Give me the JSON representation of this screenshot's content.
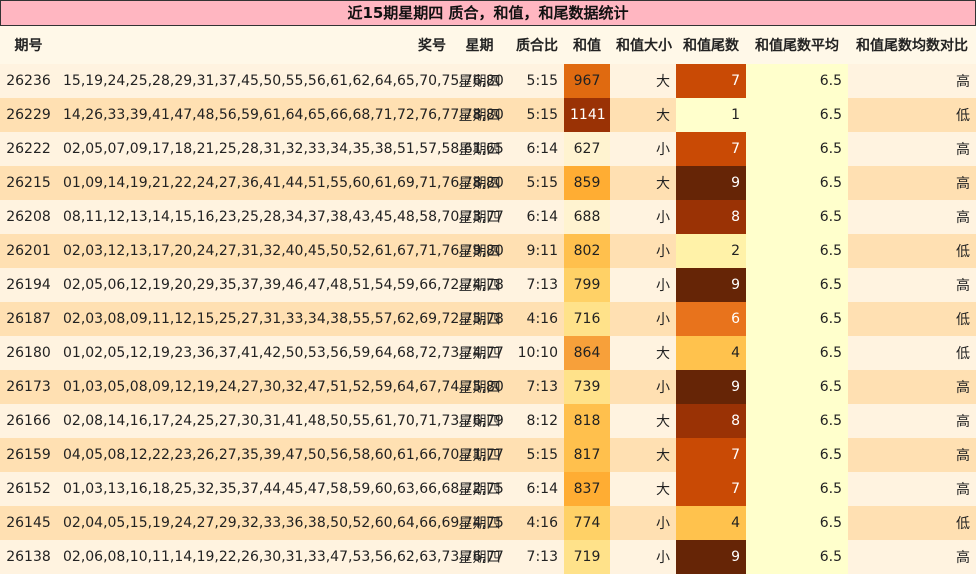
{
  "title": "近15期星期四 质合，和值，和尾数据统计",
  "columns": [
    "期号",
    "奖号",
    "星期",
    "质合比",
    "和值",
    "和值大小",
    "和值尾数",
    "和值尾数平均",
    "和值尾数均数对比"
  ],
  "colors": {
    "tail": {
      "0": "#ffffcc",
      "1": "#ffffcc",
      "2": "#fff2a8",
      "3": "#ffe082",
      "4": "#ffc24d",
      "5": "#f5a030",
      "6": "#e8731c",
      "7": "#c94a05",
      "8": "#9a3205",
      "9": "#662506"
    },
    "sum": {
      "600": "#fff3d0",
      "700": "#ffe28a",
      "750": "#ffd166",
      "800": "#ffc04d",
      "830": "#ffad33",
      "860": "#f7a03a",
      "900": "#e06a10",
      "1100": "#9a3205"
    }
  },
  "rows": [
    {
      "period": "26236",
      "numbers": "15,19,24,25,28,29,31,37,45,50,55,56,61,62,64,65,70,75,76,80",
      "weekday": "星期四",
      "ratio": "5:15",
      "sum": "967",
      "size": "大",
      "tail": "7",
      "avg": "6.5",
      "compare": "高"
    },
    {
      "period": "26229",
      "numbers": "14,26,33,39,41,47,48,56,59,61,64,65,66,68,71,72,76,77,78,80",
      "weekday": "星期四",
      "ratio": "5:15",
      "sum": "1141",
      "size": "大",
      "tail": "1",
      "avg": "6.5",
      "compare": "低"
    },
    {
      "period": "26222",
      "numbers": "02,05,07,09,17,18,21,25,28,31,32,33,34,35,38,51,57,58,61,65",
      "weekday": "星期四",
      "ratio": "6:14",
      "sum": "627",
      "size": "小",
      "tail": "7",
      "avg": "6.5",
      "compare": "高"
    },
    {
      "period": "26215",
      "numbers": "01,09,14,19,21,22,24,27,36,41,44,51,55,60,61,69,71,76,78,80",
      "weekday": "星期四",
      "ratio": "5:15",
      "sum": "859",
      "size": "大",
      "tail": "9",
      "avg": "6.5",
      "compare": "高"
    },
    {
      "period": "26208",
      "numbers": "08,11,12,13,14,15,16,23,25,28,34,37,38,43,45,48,58,70,73,77",
      "weekday": "星期四",
      "ratio": "6:14",
      "sum": "688",
      "size": "小",
      "tail": "8",
      "avg": "6.5",
      "compare": "高"
    },
    {
      "period": "26201",
      "numbers": "02,03,12,13,17,20,24,27,31,32,40,45,50,52,61,67,71,76,79,80",
      "weekday": "星期四",
      "ratio": "9:11",
      "sum": "802",
      "size": "小",
      "tail": "2",
      "avg": "6.5",
      "compare": "低"
    },
    {
      "period": "26194",
      "numbers": "02,05,06,12,19,20,29,35,37,39,46,47,48,51,54,59,66,72,74,78",
      "weekday": "星期四",
      "ratio": "7:13",
      "sum": "799",
      "size": "小",
      "tail": "9",
      "avg": "6.5",
      "compare": "高"
    },
    {
      "period": "26187",
      "numbers": "02,03,08,09,11,12,15,25,27,31,33,34,38,55,57,62,69,72,75,78",
      "weekday": "星期四",
      "ratio": "4:16",
      "sum": "716",
      "size": "小",
      "tail": "6",
      "avg": "6.5",
      "compare": "低"
    },
    {
      "period": "26180",
      "numbers": "01,02,05,12,19,23,36,37,41,42,50,53,56,59,64,68,72,73,74,77",
      "weekday": "星期四",
      "ratio": "10:10",
      "sum": "864",
      "size": "大",
      "tail": "4",
      "avg": "6.5",
      "compare": "低"
    },
    {
      "period": "26173",
      "numbers": "01,03,05,08,09,12,19,24,27,30,32,47,51,52,59,64,67,74,75,80",
      "weekday": "星期四",
      "ratio": "7:13",
      "sum": "739",
      "size": "小",
      "tail": "9",
      "avg": "6.5",
      "compare": "高"
    },
    {
      "period": "26166",
      "numbers": "02,08,14,16,17,24,25,27,30,31,41,48,50,55,61,70,71,73,76,79",
      "weekday": "星期四",
      "ratio": "8:12",
      "sum": "818",
      "size": "大",
      "tail": "8",
      "avg": "6.5",
      "compare": "高"
    },
    {
      "period": "26159",
      "numbers": "04,05,08,12,22,23,26,27,35,39,47,50,56,58,60,61,66,70,71,77",
      "weekday": "星期四",
      "ratio": "5:15",
      "sum": "817",
      "size": "大",
      "tail": "7",
      "avg": "6.5",
      "compare": "高"
    },
    {
      "period": "26152",
      "numbers": "01,03,13,16,18,25,32,35,37,44,45,47,58,59,60,63,66,68,72,75",
      "weekday": "星期四",
      "ratio": "6:14",
      "sum": "837",
      "size": "大",
      "tail": "7",
      "avg": "6.5",
      "compare": "高"
    },
    {
      "period": "26145",
      "numbers": "02,04,05,15,19,24,27,29,32,33,36,38,50,52,60,64,66,69,74,75",
      "weekday": "星期四",
      "ratio": "4:16",
      "sum": "774",
      "size": "小",
      "tail": "4",
      "avg": "6.5",
      "compare": "低"
    },
    {
      "period": "26138",
      "numbers": "02,06,08,10,11,14,19,22,26,30,31,33,47,53,56,62,63,73,76,77",
      "weekday": "星期四",
      "ratio": "7:13",
      "sum": "719",
      "size": "小",
      "tail": "9",
      "avg": "6.5",
      "compare": "高"
    }
  ]
}
